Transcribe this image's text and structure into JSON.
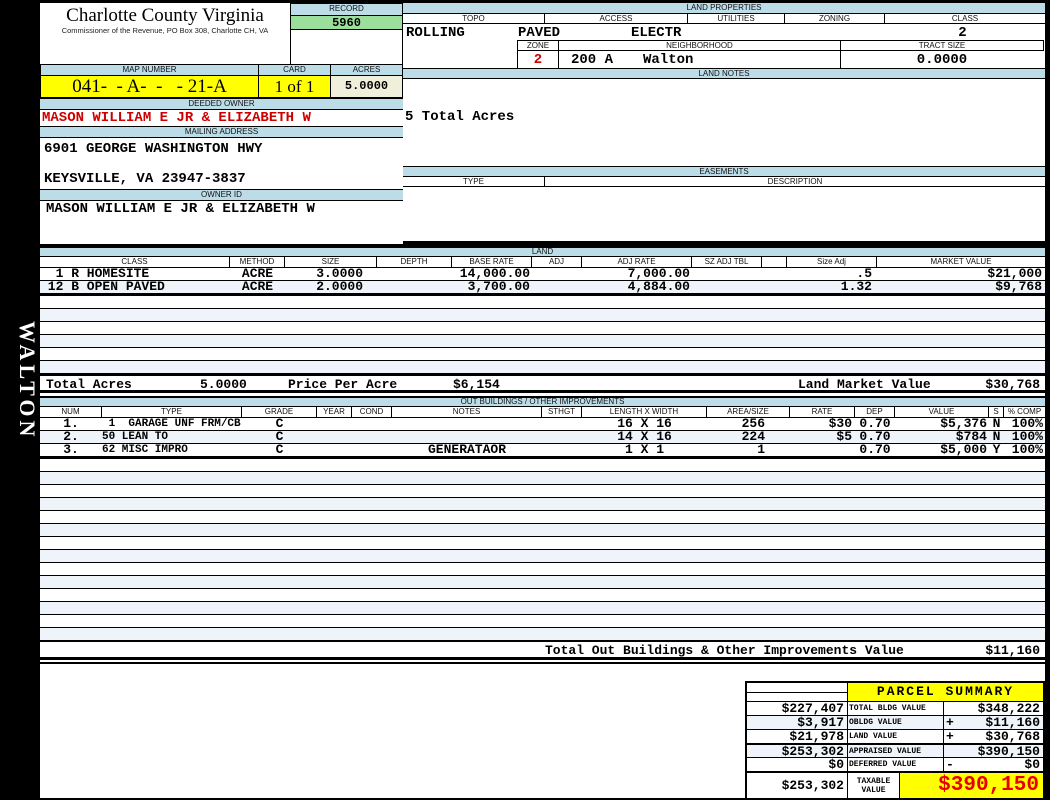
{
  "colors": {
    "header_blue": "#BCDCE8",
    "record_green": "#9CDF9C",
    "highlight_yellow": "#FFFF00",
    "acres_cream": "#F0EFDB",
    "owner_red": "#CC0000",
    "taxable_red": "#E80000",
    "stripe_blue": "#EFF3FA"
  },
  "header": {
    "county": "Charlotte County Virginia",
    "subtitle": "Commissioner of the Revenue, PO Box 308, Charlotte CH, VA",
    "record_label": "RECORD",
    "record": "5960",
    "map_number_label": "MAP NUMBER",
    "map_number": "041-  - A-  -   - 21-A",
    "card_label": "CARD",
    "card": "1 of 1",
    "acres_label": "ACRES",
    "acres": "5.0000"
  },
  "owner": {
    "deeded_owner_label": "DEEDED OWNER",
    "deeded_owner": "MASON WILLIAM E JR & ELIZABETH W",
    "mailing_address_label": "MAILING ADDRESS",
    "address_line1": "6901 GEORGE WASHINGTON HWY",
    "address_line2": "KEYSVILLE, VA 23947-3837",
    "owner_id_label": "OWNER ID",
    "owner_id": "MASON WILLIAM E JR & ELIZABETH W"
  },
  "land_properties": {
    "title": "LAND PROPERTIES",
    "topo_label": "TOPO",
    "topo": "ROLLING",
    "access_label": "ACCESS",
    "access": "PAVED",
    "utilities_label": "UTILITIES",
    "utilities": "ELECTR",
    "zoning_label": "ZONING",
    "zoning": "",
    "class_label": "CLASS",
    "class": "2",
    "zone_label": "ZONE",
    "zone": "2",
    "neighborhood_label": "NEIGHBORHOOD",
    "neighborhood_code": "200 A",
    "neighborhood": "Walton",
    "tract_size_label": "TRACT SIZE",
    "tract_size": "0.0000"
  },
  "land_notes": {
    "title": "LAND NOTES",
    "note": "5 Total Acres"
  },
  "easements": {
    "title": "EASEMENTS",
    "type_label": "TYPE",
    "description_label": "DESCRIPTION"
  },
  "land": {
    "title": "LAND",
    "headers": [
      "CLASS",
      "METHOD",
      "SIZE",
      "DEPTH",
      "BASE RATE",
      "ADJ",
      "ADJ RATE",
      "SZ ADJ TBL",
      "",
      "Size Adj",
      "MARKET VALUE"
    ],
    "rows": [
      {
        "class": "  1 R HOMESITE",
        "method": "ACRE",
        "size": "3.0000",
        "depth": "",
        "base_rate": "14,000.00",
        "adj": "",
        "adj_rate": "7,000.00",
        "sz_adj_tbl": "",
        "size_adj": ".5",
        "market_value": "$21,000"
      },
      {
        "class": " 12 B OPEN PAVED",
        "method": "ACRE",
        "size": "2.0000",
        "depth": "",
        "base_rate": "3,700.00",
        "adj": "",
        "adj_rate": "4,884.00",
        "sz_adj_tbl": "",
        "size_adj": "1.32",
        "market_value": "$9,768"
      }
    ],
    "total_acres_label": "Total Acres",
    "total_acres": "5.0000",
    "price_per_acre_label": "Price Per Acre",
    "price_per_acre": "$6,154",
    "land_market_value_label": "Land Market Value",
    "land_market_value": "$30,768"
  },
  "outbuildings": {
    "title": "OUT BUILDINGS / OTHER IMPROVEMENTS",
    "headers": [
      "NUM",
      "TYPE",
      "GRADE",
      "YEAR",
      "COND",
      "NOTES",
      "STHGT",
      "LENGTH X WIDTH",
      "AREA/SIZE",
      "RATE",
      "DEP",
      "VALUE",
      "S",
      "% COMP"
    ],
    "rows": [
      {
        "num": "1.",
        "type": " 1  GARAGE UNF FRM/CB",
        "grade": "C",
        "year": "",
        "cond": "",
        "notes": "",
        "sthgt": "",
        "lxw": "16 X 16",
        "area": "256",
        "rate": "$30",
        "dep": "0.70",
        "value": "$5,376",
        "s": "N",
        "comp": "100%"
      },
      {
        "num": "2.",
        "type": "50 LEAN TO",
        "grade": "C",
        "year": "",
        "cond": "",
        "notes": "",
        "sthgt": "",
        "lxw": "14 X 16",
        "area": "224",
        "rate": "$5",
        "dep": "0.70",
        "value": "$784",
        "s": "N",
        "comp": "100%"
      },
      {
        "num": "3.",
        "type": "62 MISC IMPRO",
        "grade": "C",
        "year": "",
        "cond": "",
        "notes": "GENERATAOR",
        "sthgt": "",
        "lxw": "1 X 1",
        "area": "1",
        "rate": "",
        "dep": "0.70",
        "value": "$5,000",
        "s": "Y",
        "comp": "100%"
      }
    ],
    "total_label": "Total Out Buildings & Other Improvements Value",
    "total_value": "$11,160"
  },
  "parcel_summary": {
    "title": "PARCEL SUMMARY",
    "rows": [
      {
        "left": "$227,407",
        "label": "TOTAL BLDG VALUE",
        "sign": "",
        "value": "$348,222"
      },
      {
        "left": "$3,917",
        "label": "OBLDG VALUE",
        "sign": "+",
        "value": "$11,160"
      },
      {
        "left": "$21,978",
        "label": "LAND VALUE",
        "sign": "+",
        "value": "$30,768"
      },
      {
        "left": "$253,302",
        "label": "APPRAISED VALUE",
        "sign": "",
        "value": "$390,150"
      },
      {
        "left": "$0",
        "label": "DEFERRED VALUE",
        "sign": "-",
        "value": "$0"
      }
    ],
    "taxable": {
      "left": "$253,302",
      "label": "TAXABLE VALUE",
      "value": "$390,150"
    }
  },
  "sidebar": {
    "neighborhood_name": "WALTON"
  }
}
